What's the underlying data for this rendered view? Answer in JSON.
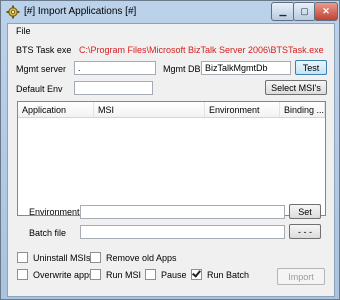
{
  "window": {
    "title": "[#] Import Applications [#]"
  },
  "menu": {
    "file": "File"
  },
  "form": {
    "bts_task_exe_label": "BTS Task exe",
    "bts_task_exe_path": "C:\\Program Files\\Microsoft BizTalk Server 2006\\BTSTask.exe",
    "mgmt_server_label": "Mgmt server",
    "mgmt_server_value": ".",
    "mgmt_db_label": "Mgmt DB",
    "mgmt_db_value": "BizTalkMgmtDb",
    "test_button": "Test",
    "default_env_label": "Default Env",
    "default_env_value": "",
    "select_msis_button": "Select MSI's"
  },
  "list": {
    "columns": [
      "Application",
      "MSI",
      "Environment",
      "Binding ..."
    ],
    "rows": []
  },
  "environment_row": {
    "label": "Environment",
    "value": "",
    "button": "Set"
  },
  "batch_row": {
    "label": "Batch file",
    "value": "",
    "button": "- - -"
  },
  "options": {
    "uninstall_msis": {
      "label": "Uninstall MSIs",
      "checked": false
    },
    "remove_old_apps": {
      "label": "Remove old Apps",
      "checked": false
    },
    "overwrite_apps": {
      "label": "Overwrite apps",
      "checked": false
    },
    "run_msi": {
      "label": "Run MSI",
      "checked": false
    },
    "pause": {
      "label": "Pause",
      "checked": false
    },
    "run_batch": {
      "label": "Run Batch",
      "checked": true
    }
  },
  "import_button": "Import",
  "colors": {
    "path_text": "#d42020",
    "titlebar": "#bcd2ea"
  },
  "icons": {
    "app": "gear-icon",
    "minimize": "minimize-icon",
    "maximize": "maximize-icon",
    "close": "close-icon"
  }
}
